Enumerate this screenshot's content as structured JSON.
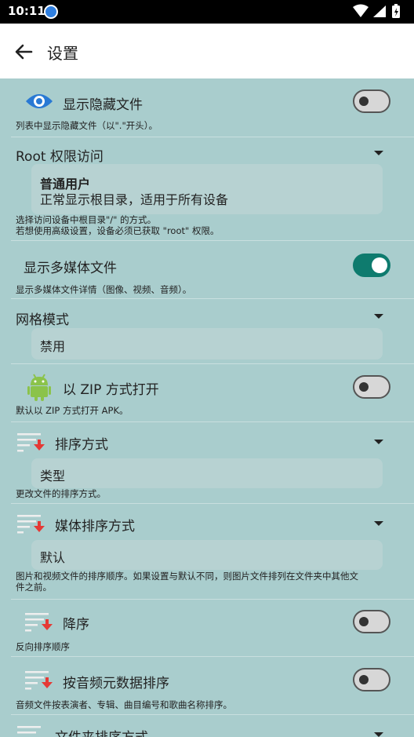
{
  "status": {
    "time": "10:11"
  },
  "appbar": {
    "title": "设置"
  },
  "prefs": {
    "hidden": {
      "label": "显示隐藏文件",
      "summary": "列表中显示隐藏文件（以\".\"开头）。"
    },
    "root": {
      "label": "Root 权限访问",
      "selected_title": "普通用户",
      "selected_desc": "正常显示根目录，适用于所有设备",
      "summary_1": "选择访问设备中根目录\"/\" 的方式。",
      "summary_2": "若想使用高级设置，设备必须已获取 \"root\" 权限。"
    },
    "media": {
      "label": "显示多媒体文件",
      "summary": "显示多媒体文件详情（图像、视频、音频）。"
    },
    "grid": {
      "label": "网格模式",
      "value": "禁用"
    },
    "zip": {
      "label": "以 ZIP 方式打开",
      "summary": "默认以 ZIP 方式打开 APK。"
    },
    "sort": {
      "label": "排序方式",
      "value": "类型",
      "summary": "更改文件的排序方式。"
    },
    "media_sort": {
      "label": "媒体排序方式",
      "value": "默认",
      "summary_1": "图片和视频文件的排序顺序。如果设置与默认不同，则图片文件排列在文件夹中其他文",
      "summary_2": "件之前。"
    },
    "desc": {
      "label": "降序",
      "summary": "反向排序顺序"
    },
    "audio_meta": {
      "label": "按音频元数据排序",
      "summary": "音频文件按表演者、专辑、曲目编号和歌曲名称排序。"
    },
    "folder_sort": {
      "label": "文件夹排序方式"
    }
  },
  "toggles": {
    "hidden": false,
    "media": true,
    "zip": false,
    "desc": false,
    "audio_meta": false
  },
  "colors": {
    "background": "#a9cdcd",
    "toggle_on": "#0e7b6e",
    "sort_arrow": "#e53935"
  }
}
